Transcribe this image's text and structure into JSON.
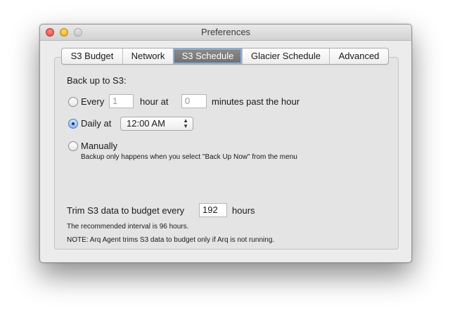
{
  "window": {
    "title": "Preferences"
  },
  "tabs": [
    {
      "label": "S3 Budget",
      "active": false
    },
    {
      "label": "Network",
      "active": false
    },
    {
      "label": "S3 Schedule",
      "active": true
    },
    {
      "label": "Glacier Schedule",
      "active": false
    },
    {
      "label": "Advanced",
      "active": false
    }
  ],
  "schedule": {
    "heading": "Back up to S3:",
    "every": {
      "label": "Every",
      "hours_value": "1",
      "hour_at_label": "hour at",
      "minutes_value": "0",
      "minutes_label": "minutes past the hour",
      "selected": false
    },
    "daily": {
      "label": "Daily at",
      "time_value": "12:00 AM",
      "selected": true
    },
    "manual": {
      "label": "Manually",
      "note": "Backup only happens when you select \"Back Up Now\" from the menu",
      "selected": false
    }
  },
  "trim": {
    "label_before": "Trim S3 data to budget every",
    "hours_value": "192",
    "label_after": "hours",
    "recommended": "The recommended interval is 96 hours.",
    "note": "NOTE: Arq Agent trims S3 data to budget only if Arq is not running."
  },
  "colors": {
    "active_tab": "#7a7a7a",
    "focus_ring": "#7fb0ea",
    "window_bg": "#ececec"
  },
  "icons": {
    "popup_arrows": "up-down-arrows-icon"
  }
}
